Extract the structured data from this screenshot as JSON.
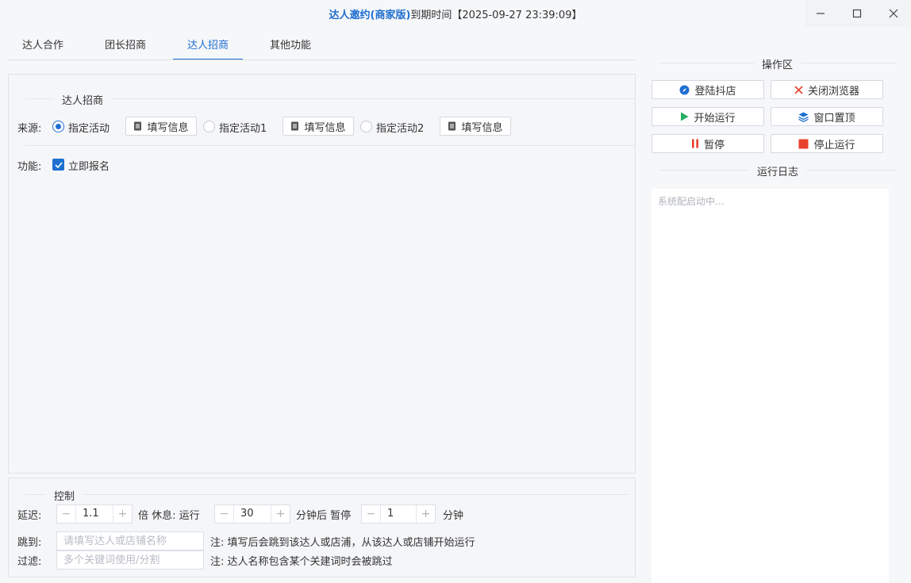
{
  "window": {
    "app_name": "达人邀约(商家版)",
    "expiry_label": "到期时间",
    "expiry_value": "【2025-09-27 23:39:09】"
  },
  "tabs": [
    {
      "label": "达人合作"
    },
    {
      "label": "团长招商"
    },
    {
      "label": "达人招商"
    },
    {
      "label": "其他功能"
    }
  ],
  "recruit": {
    "section_title": "达人招商",
    "source_label": "来源:",
    "options": [
      {
        "label": "指定活动",
        "checked": true
      },
      {
        "label": "指定活动1",
        "checked": false
      },
      {
        "label": "指定活动2",
        "checked": false
      }
    ],
    "fill_info_label": "填写信息",
    "function_label": "功能:",
    "signup_label": "立即报名"
  },
  "control": {
    "section_title": "控制",
    "delay_label": "延迟:",
    "delay_value": "1.1",
    "rest_label": "倍 休息: 运行",
    "run_value": "30",
    "pause_label": "分钟后 暂停",
    "pause_value": "1",
    "minute_label": "分钟",
    "jump_label": "跳到:",
    "jump_placeholder": "请填写达人或店铺名称",
    "jump_note": "注: 填写后会跳到该达人或店浦，从该达人或店铺开始运行",
    "filter_label": "过滤:",
    "filter_placeholder": "多个关键词使用/分割",
    "filter_note": "注: 达人名称包含某个关建词时会被跳过"
  },
  "ops": {
    "title": "操作区",
    "login": "登陆抖店",
    "close_browser": "关闭浏览器",
    "start": "开始运行",
    "pin_window": "窗口置顶",
    "pause": "暂停",
    "stop": "停止运行"
  },
  "log": {
    "title": "运行日志",
    "text": "系统配启动中..."
  },
  "colors": {
    "accent": "#1f6fd1",
    "start_green": "#27ae60",
    "stop_red": "#e8402a"
  }
}
